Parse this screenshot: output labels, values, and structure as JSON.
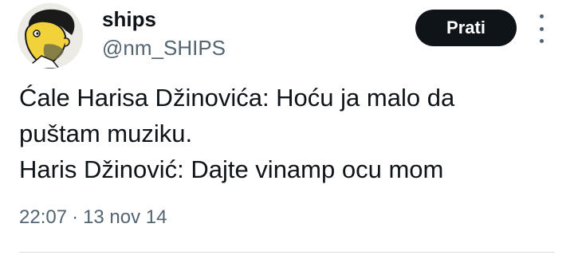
{
  "author": {
    "display_name": "ships",
    "handle": "@nm_SHIPS",
    "avatar_icon": "cartoon-face-avatar-icon"
  },
  "follow_button": {
    "label": "Prati"
  },
  "more_icon": "more-vertical-icon",
  "tweet": {
    "lines": [
      "Ćale Harisa Džinovića: Hoću ja malo da",
      "puštam muziku.",
      "Haris Džinović: Dajte vinamp ocu mom"
    ]
  },
  "meta": {
    "time": "22:07",
    "separator": "·",
    "date": "13 nov 14"
  },
  "colors": {
    "text": "#0f1419",
    "secondary": "#536471",
    "button_bg": "#0f1419",
    "button_text": "#ffffff",
    "divider": "#d7dde1"
  }
}
